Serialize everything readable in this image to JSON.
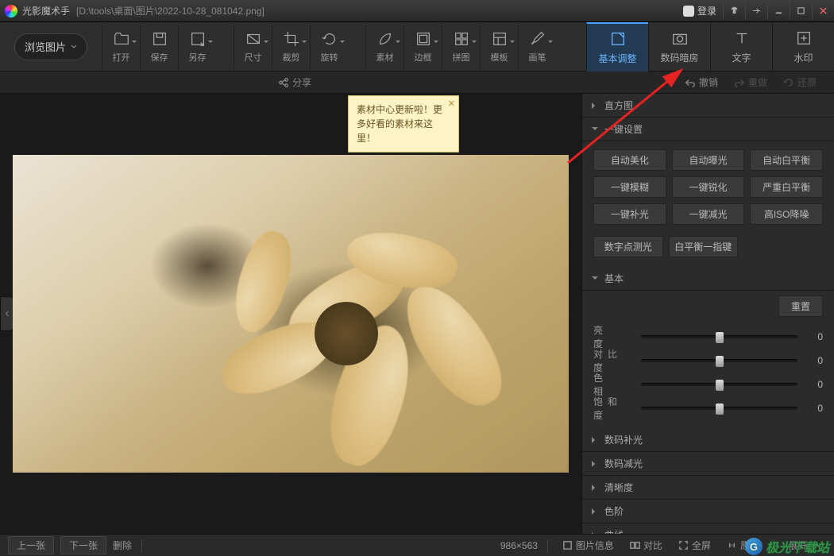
{
  "title": {
    "app": "光影魔术手",
    "path": "[D:\\tools\\桌面\\图片\\2022-10-28_081042.png]"
  },
  "login": "登录",
  "browse": "浏览图片",
  "tools": {
    "open": "打开",
    "save": "保存",
    "saveas": "另存",
    "size": "尺寸",
    "crop": "裁剪",
    "rotate": "旋转",
    "material": "素材",
    "frame": "边框",
    "puzzle": "拼图",
    "template": "模板",
    "brush": "画笔"
  },
  "modes": {
    "basic": "基本调整",
    "darkroom": "数码暗房",
    "text": "文字",
    "watermark": "水印"
  },
  "secondbar": {
    "share": "分享",
    "undo": "撤销",
    "redo": "重做",
    "restore": "还原"
  },
  "tooltip": {
    "line": "素材中心更新啦！更多好看的素材来这里！"
  },
  "panels": {
    "histogram": "直方图",
    "oneclick": "一键设置",
    "basic": "基本",
    "digitalfill": "数码补光",
    "digitaldim": "数码减光",
    "sharpness": "清晰度",
    "levels": "色阶",
    "curve": "曲线"
  },
  "oneclick_btns": [
    "自动美化",
    "自动曝光",
    "自动白平衡",
    "一键模糊",
    "一键锐化",
    "严重白平衡",
    "一键补光",
    "一键减光",
    "高ISO降噪"
  ],
  "extra_btns": [
    "数字点测光",
    "白平衡一指键"
  ],
  "basic_section": {
    "reset": "重置",
    "sliders": [
      {
        "label": "亮　度",
        "value": "0"
      },
      {
        "label": "对比度",
        "value": "0"
      },
      {
        "label": "色　相",
        "value": "0"
      },
      {
        "label": "饱和度",
        "value": "0"
      }
    ]
  },
  "bottom": {
    "prev": "上一张",
    "next": "下一张",
    "delete": "删除",
    "dims": "986×563",
    "info": "图片信息",
    "compare": "对比",
    "fullscreen": "全屏",
    "original": "原大",
    "expand": "展开"
  },
  "watermark_site": "极光下载站"
}
